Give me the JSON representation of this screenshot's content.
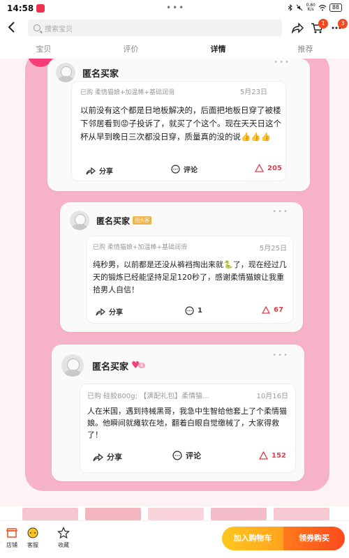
{
  "status_bar": {
    "time": "14:58",
    "dots": "•••",
    "speed_top": "0.80",
    "speed_unit": "K/s",
    "battery": "88"
  },
  "header": {
    "search_placeholder": "搜索宝贝",
    "cart_badge": "1",
    "more_badge": "3"
  },
  "tabs": [
    {
      "label": "宝贝",
      "active": false
    },
    {
      "label": "评价",
      "active": false
    },
    {
      "label": "详情",
      "active": true
    },
    {
      "label": "推荐",
      "active": false
    }
  ],
  "reviews": [
    {
      "user": "匿名买家",
      "purchase": "已购 柔情猫娘+加温棒+基础润滑",
      "date": "5月23日",
      "text": "以前没有这个都是日地板解决的，后面把地板日穿了被楼下邻居看到😡子投诉了，就买了个这个。现在天天日这个杯从早到晚日三次都没日穿，质量真的没的说👍👍👍",
      "share": "分享",
      "comment": "评论",
      "likes": "205"
    },
    {
      "user": "匿名买家",
      "badge": "回头客",
      "purchase": "已购 柔情猫娘+加温棒+基础润滑",
      "date": "5月25日",
      "text": "纯秒男，以前都是还没从裤裆掏出来就🐍了，现在经过几天的锻炼已经能坚持足足120秒了，感谢柔情猫娘让我重拾男人自信！",
      "share": "分享",
      "comment": "1",
      "likes": "67"
    },
    {
      "user": "匿名买家",
      "level": "4",
      "purchase": "已购 硅胶800g; 【满配礼包】柔情猫...",
      "date": "10月16日",
      "text": "人在米国，遇到持械黑哥，我急中生智给他套上了个柔情猫娘。他瞬间就瘫软在地，翻着白眼自觉缴械了，大家得救了！",
      "share": "分享",
      "comment": "评论",
      "likes": "152"
    }
  ],
  "bottom_bar": {
    "shop": "店铺",
    "service": "客服",
    "favorite": "收藏",
    "add_cart": "加入购物车",
    "buy": "领券购买"
  },
  "colors": {
    "accent_red": "#e23f4a",
    "pink_frame": "#f6b2c6",
    "cart_button": "#ffb41e",
    "buy_button": "#ff5a1d"
  }
}
